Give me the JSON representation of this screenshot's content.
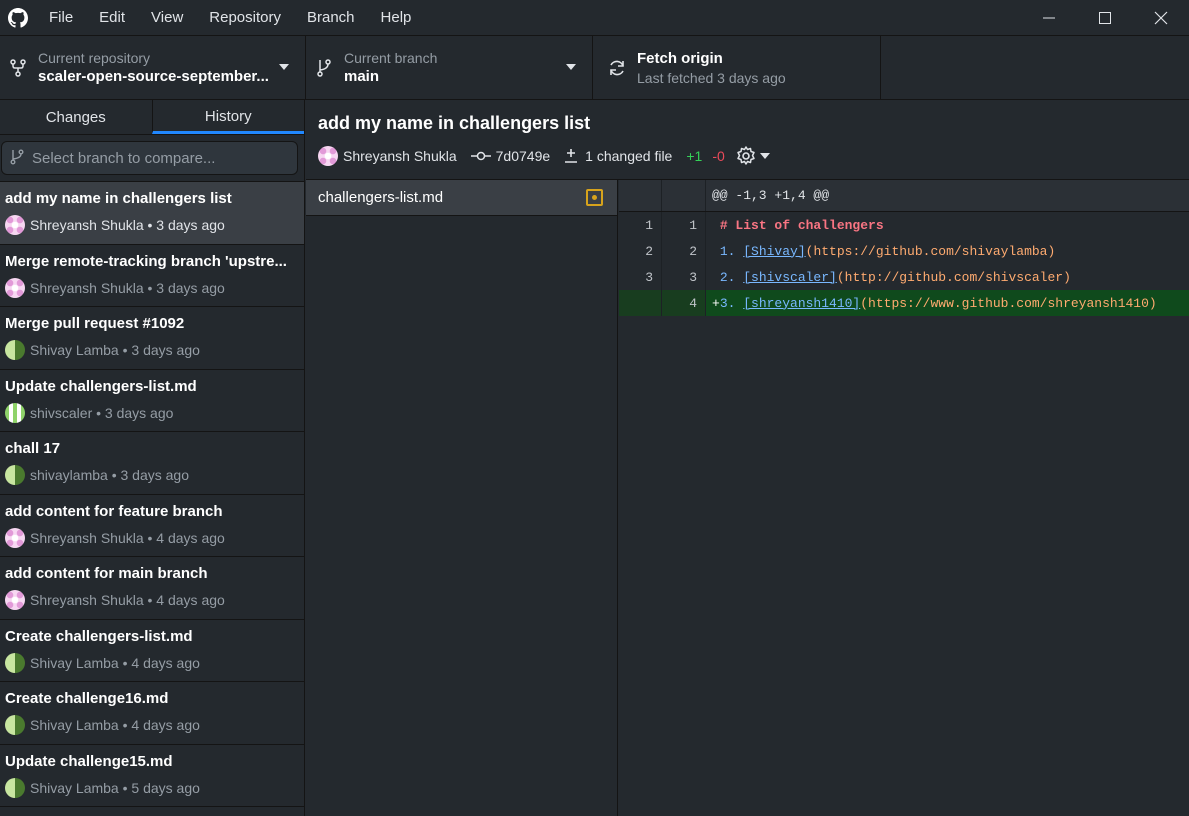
{
  "menu": [
    "File",
    "Edit",
    "View",
    "Repository",
    "Branch",
    "Help"
  ],
  "toolbar": {
    "repo_label": "Current repository",
    "repo_value": "scaler-open-source-september...",
    "branch_label": "Current branch",
    "branch_value": "main",
    "fetch_title": "Fetch origin",
    "fetch_sub": "Last fetched 3 days ago"
  },
  "tabs": {
    "changes": "Changes",
    "history": "History"
  },
  "compare_placeholder": "Select branch to compare...",
  "commits": [
    {
      "title": "add my name in challengers list",
      "meta": "Shreyansh Shukla • 3 days ago",
      "avatar": "pink"
    },
    {
      "title": "Merge remote-tracking branch 'upstre...",
      "meta": "Shreyansh Shukla • 3 days ago",
      "avatar": "pink"
    },
    {
      "title": "Merge pull request #1092",
      "meta": "Shivay Lamba • 3 days ago",
      "avatar": "green"
    },
    {
      "title": "Update challengers-list.md",
      "meta": "shivscaler • 3 days ago",
      "avatar": "stripe"
    },
    {
      "title": "chall 17",
      "meta": "shivaylamba • 3 days ago",
      "avatar": "green"
    },
    {
      "title": "add content for feature branch",
      "meta": "Shreyansh Shukla • 4 days ago",
      "avatar": "pink"
    },
    {
      "title": "add content for main branch",
      "meta": "Shreyansh Shukla • 4 days ago",
      "avatar": "pink"
    },
    {
      "title": "Create challengers-list.md",
      "meta": "Shivay Lamba • 4 days ago",
      "avatar": "green"
    },
    {
      "title": "Create challenge16.md",
      "meta": "Shivay Lamba • 4 days ago",
      "avatar": "green"
    },
    {
      "title": "Update challenge15.md",
      "meta": "Shivay Lamba • 5 days ago",
      "avatar": "green"
    }
  ],
  "header": {
    "title": "add my name in challengers list",
    "author": "Shreyansh Shukla",
    "sha": "7d0749e",
    "changed": "1 changed file",
    "additions": "+1",
    "deletions": "-0"
  },
  "file": "challengers-list.md",
  "diff": {
    "hunk": "@@ -1,3 +1,4 @@",
    "lines": [
      {
        "old": "1",
        "new": "1",
        "prefix": " ",
        "parts": [
          {
            "cls": "md-head",
            "t": "# List of challengers"
          }
        ]
      },
      {
        "old": "2",
        "new": "2",
        "prefix": " ",
        "parts": [
          {
            "cls": "md-num",
            "t": "1. "
          },
          {
            "cls": "md-link",
            "t": "[Shivay]"
          },
          {
            "cls": "md-url",
            "t": "(https://github.com/shivaylamba)"
          }
        ]
      },
      {
        "old": "3",
        "new": "3",
        "prefix": " ",
        "parts": [
          {
            "cls": "md-num",
            "t": "2. "
          },
          {
            "cls": "md-link",
            "t": "[shivscaler]"
          },
          {
            "cls": "md-url",
            "t": "(http://github.com/shivscaler)"
          }
        ]
      },
      {
        "old": "",
        "new": "4",
        "prefix": "+",
        "added": true,
        "parts": [
          {
            "cls": "md-num",
            "t": "3. "
          },
          {
            "cls": "md-link",
            "t": "[shreyansh1410]"
          },
          {
            "cls": "md-url",
            "t": "(https://www.github.com/shreyansh1410)"
          }
        ]
      }
    ]
  }
}
